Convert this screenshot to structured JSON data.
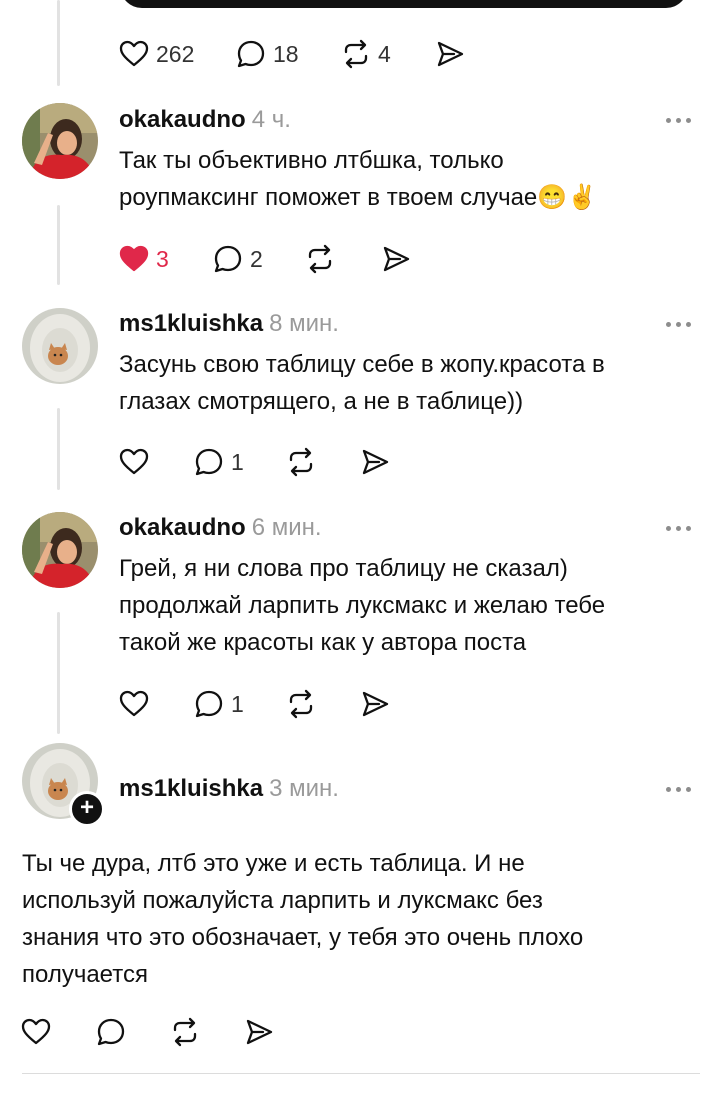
{
  "post_actions": {
    "likes": "262",
    "replies": "18",
    "reposts": "4"
  },
  "comments": [
    {
      "username": "okakaudno",
      "time": "4 ч.",
      "text": "Так ты объективно лтбшка, только\nроупмаксинг поможет в твоем случае😁✌️",
      "likes": "3",
      "liked": true,
      "replies": "2",
      "accent": "#e0284a"
    },
    {
      "username": "ms1kluishka",
      "time": "8 мин.",
      "text": "Засунь свою таблицу себе в жопу.красота в\nглазах смотрящего, а не в таблице))",
      "likes": "",
      "replies": "1"
    },
    {
      "username": "okakaudno",
      "time": "6 мин.",
      "text": "Грей, я ни слова про таблицу не сказал)\nпродолжай ларпить луксмакс и желаю тебе\nтакой же красоты как у автора поста",
      "likes": "",
      "replies": "1"
    },
    {
      "username": "ms1kluishka",
      "time": "3 мин.",
      "text": "Ты че дура, лтб это уже и есть  таблица. И не\nиспользуй пожалуйста ларпить и луксмакс без\nзнания что это обозначает, у тебя это очень плохо\nполучается",
      "likes": "",
      "replies": ""
    }
  ],
  "icons": {
    "heart": "heart-icon",
    "reply": "reply-bubble-icon",
    "repost": "repost-icon",
    "share": "share-icon",
    "more": "more-options-icon"
  },
  "plus_badge": "+"
}
